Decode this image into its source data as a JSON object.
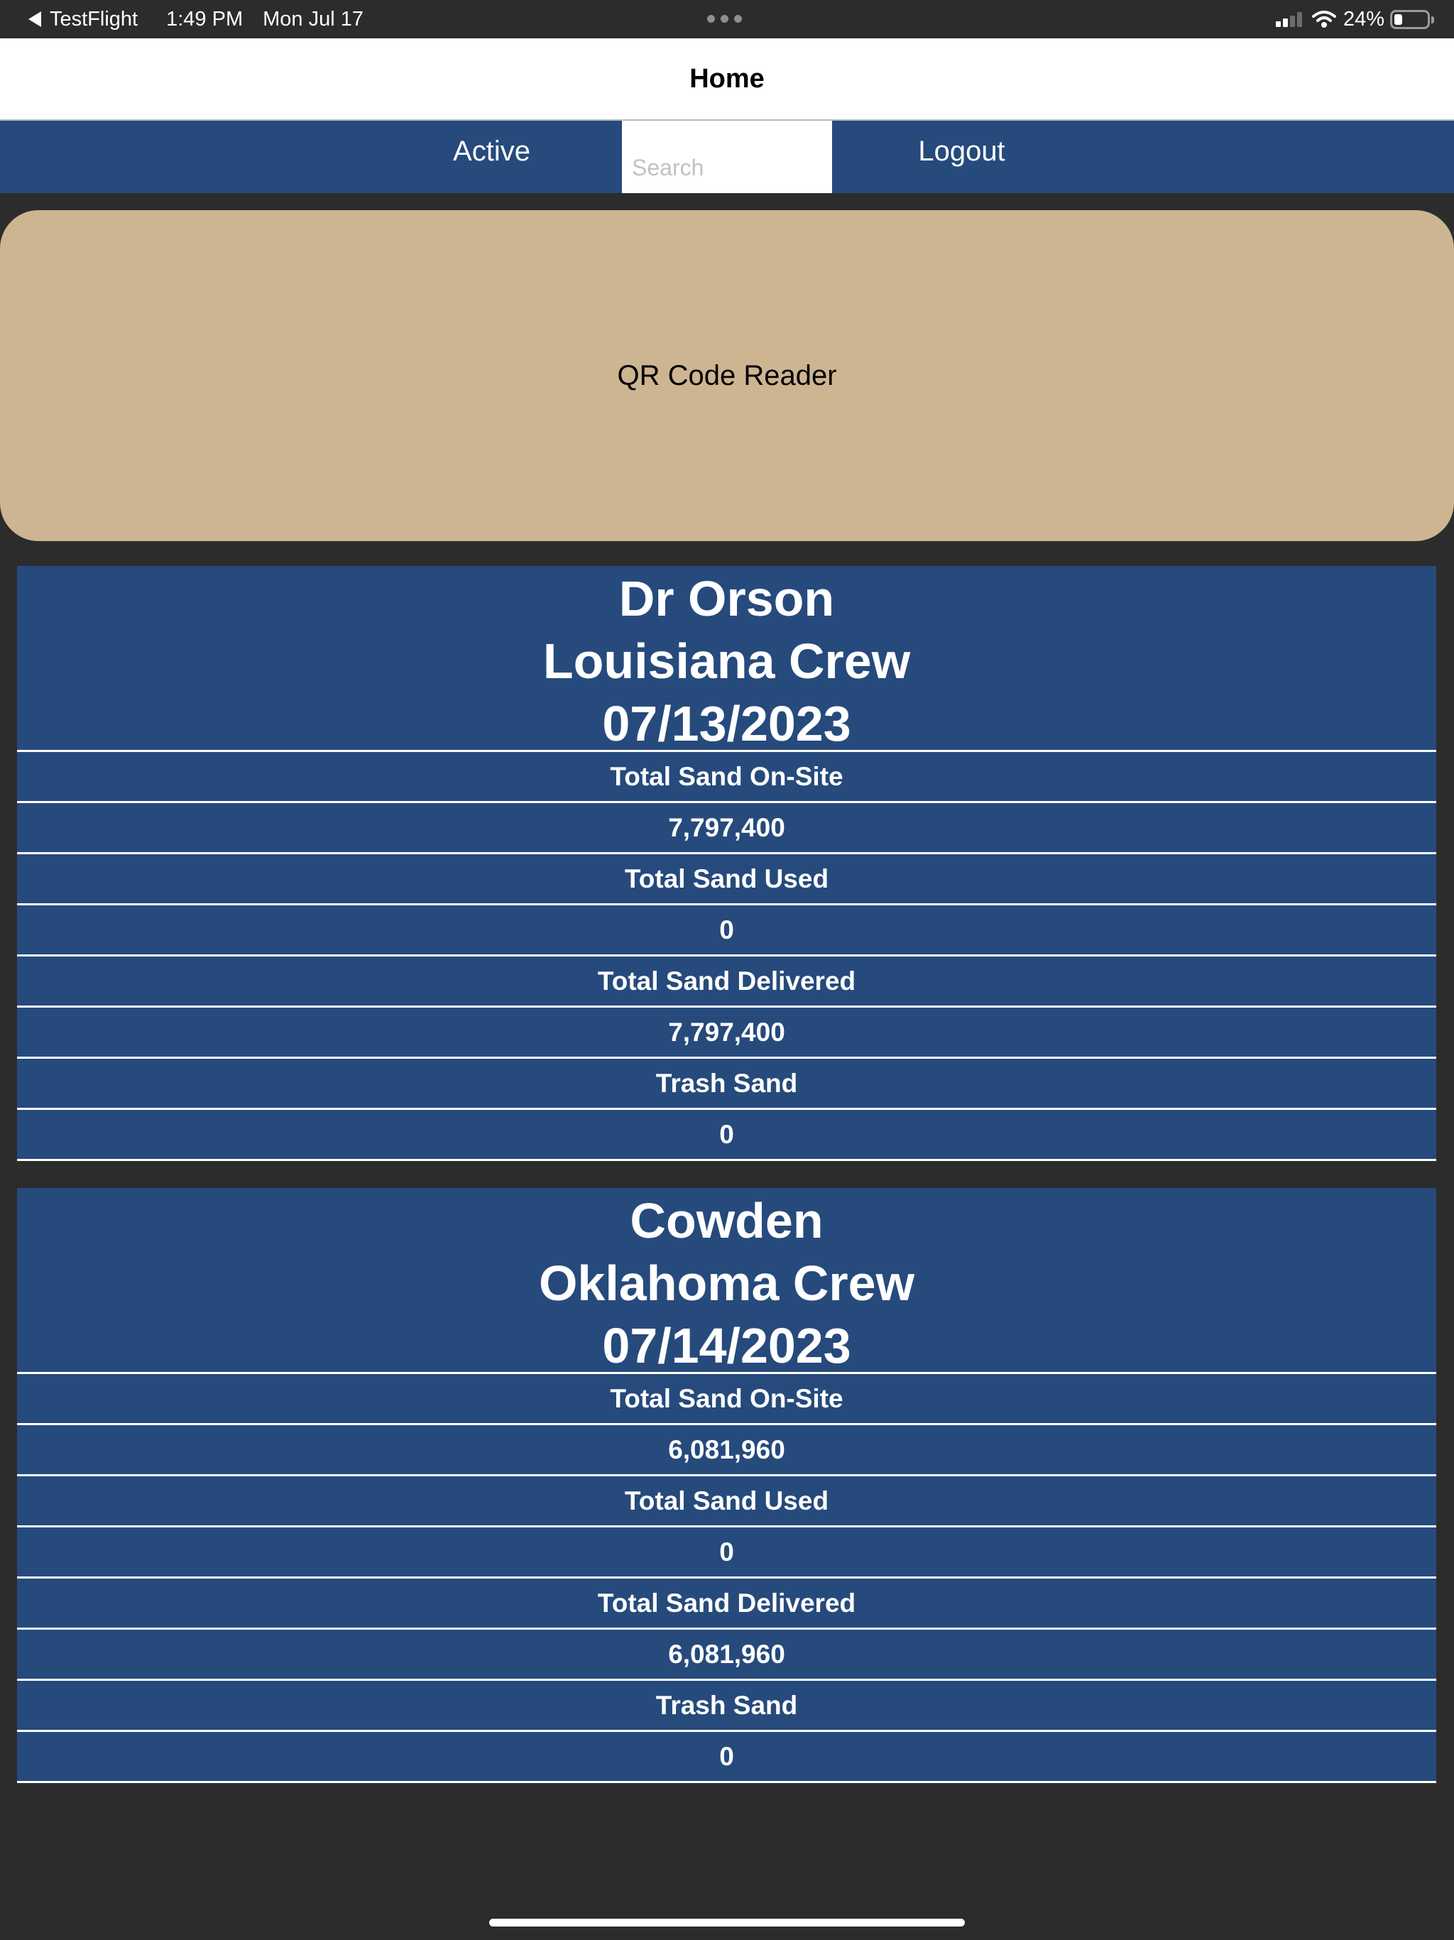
{
  "status_bar": {
    "back_app": "TestFlight",
    "time": "1:49 PM",
    "date": "Mon Jul 17",
    "battery_percent": "24%",
    "battery_level": 0.24,
    "signal_bars": 2,
    "icons": [
      "back-arrow-icon",
      "more-dots-icon",
      "signal-icon",
      "wifi-icon",
      "battery-icon"
    ]
  },
  "nav": {
    "title": "Home"
  },
  "toolbar": {
    "active_label": "Active",
    "search_placeholder": "Search",
    "search_value": "",
    "logout_label": "Logout"
  },
  "qr_reader": {
    "label": "QR Code Reader"
  },
  "sites": [
    {
      "name": "Dr Orson",
      "crew": "Louisiana Crew",
      "date": "07/13/2023",
      "stats": [
        {
          "label": "Total Sand On-Site",
          "value": "7,797,400"
        },
        {
          "label": "Total Sand Used",
          "value": "0"
        },
        {
          "label": "Total Sand Delivered",
          "value": "7,797,400"
        },
        {
          "label": "Trash Sand",
          "value": "0"
        }
      ]
    },
    {
      "name": "Cowden",
      "crew": "Oklahoma Crew",
      "date": "07/14/2023",
      "stats": [
        {
          "label": "Total Sand On-Site",
          "value": "6,081,960"
        },
        {
          "label": "Total Sand Used",
          "value": "0"
        },
        {
          "label": "Total Sand Delivered",
          "value": "6,081,960"
        },
        {
          "label": "Trash Sand",
          "value": "0"
        }
      ]
    }
  ],
  "colors": {
    "background": "#2c2c2c",
    "navy": "#264a7c",
    "qr_button": "#cdb592",
    "text_light": "#ffffff"
  }
}
